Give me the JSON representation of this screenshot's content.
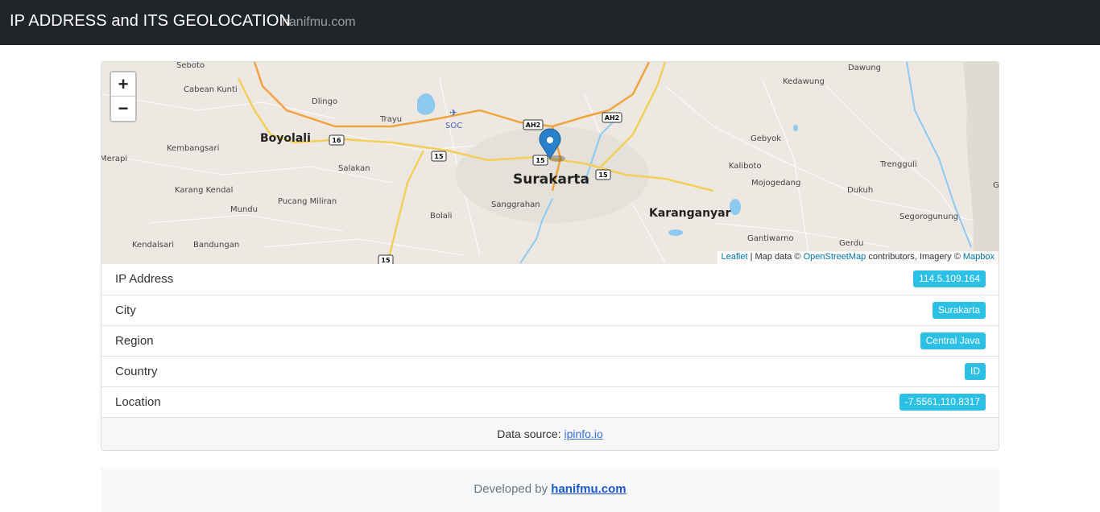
{
  "navbar": {
    "brand": "IP ADDRESS and ITS GEOLOCATION",
    "link": "hanifmu.com"
  },
  "map": {
    "zoom_in": "+",
    "zoom_out": "−",
    "labels": {
      "seboto": "Seboto",
      "cabean_kunti": "Cabean Kunti",
      "dlingo": "Dlingo",
      "trayu": "Trayu",
      "soc": "SOC",
      "boyolali": "Boyolali",
      "kembangsari": "Kembangsari",
      "merapi": "Merapi",
      "salakan": "Salakan",
      "karang_kendal": "Karang Kendal",
      "pucang_miliran": "Pucang Miliran",
      "mundu": "Mundu",
      "bolali": "Bolali",
      "sanggrahan": "Sanggrahan",
      "surakarta": "Surakarta",
      "kendalsari": "Kendalsari",
      "bandungan": "Bandungan",
      "dawung": "Dawung",
      "kedawung": "Kedawung",
      "gebyok": "Gebyok",
      "kaliboto": "Kaliboto",
      "mojogedang": "Mojogedang",
      "trengguli": "Trengguli",
      "dukuh": "Dukuh",
      "karanganyar": "Karanganyar",
      "segorogunung": "Segorogunung",
      "gantiwarno": "Gantiwarno",
      "gerdu": "Gerdu",
      "g_edge": "G",
      "ah2": "AH2",
      "r16": "16",
      "r15": "15"
    },
    "attribution": {
      "leaflet": "Leaflet",
      "sep": " | Map data © ",
      "osm": "OpenStreetMap",
      "mid": " contributors, Imagery © ",
      "mapbox": "Mapbox"
    },
    "colors": {
      "land": "#ede9e2",
      "major_road": "#f1a340",
      "secondary_road": "#f3cf5a",
      "water": "#8ec9ef",
      "marker": "#2a81cb"
    }
  },
  "details": [
    {
      "label": "IP Address",
      "value": "114.5.109.164"
    },
    {
      "label": "City",
      "value": "Surakarta"
    },
    {
      "label": "Region",
      "value": "Central Java"
    },
    {
      "label": "Country",
      "value": "ID"
    },
    {
      "label": "Location",
      "value": "-7.5561,110.8317"
    }
  ],
  "card_footer": {
    "prefix": "Data source: ",
    "link": "ipinfo.io"
  },
  "page_footer": {
    "prefix": "Developed by ",
    "link": "hanifmu.com"
  },
  "colors": {
    "navbar_bg": "#212529",
    "badge_bg": "#2bc0e4"
  }
}
